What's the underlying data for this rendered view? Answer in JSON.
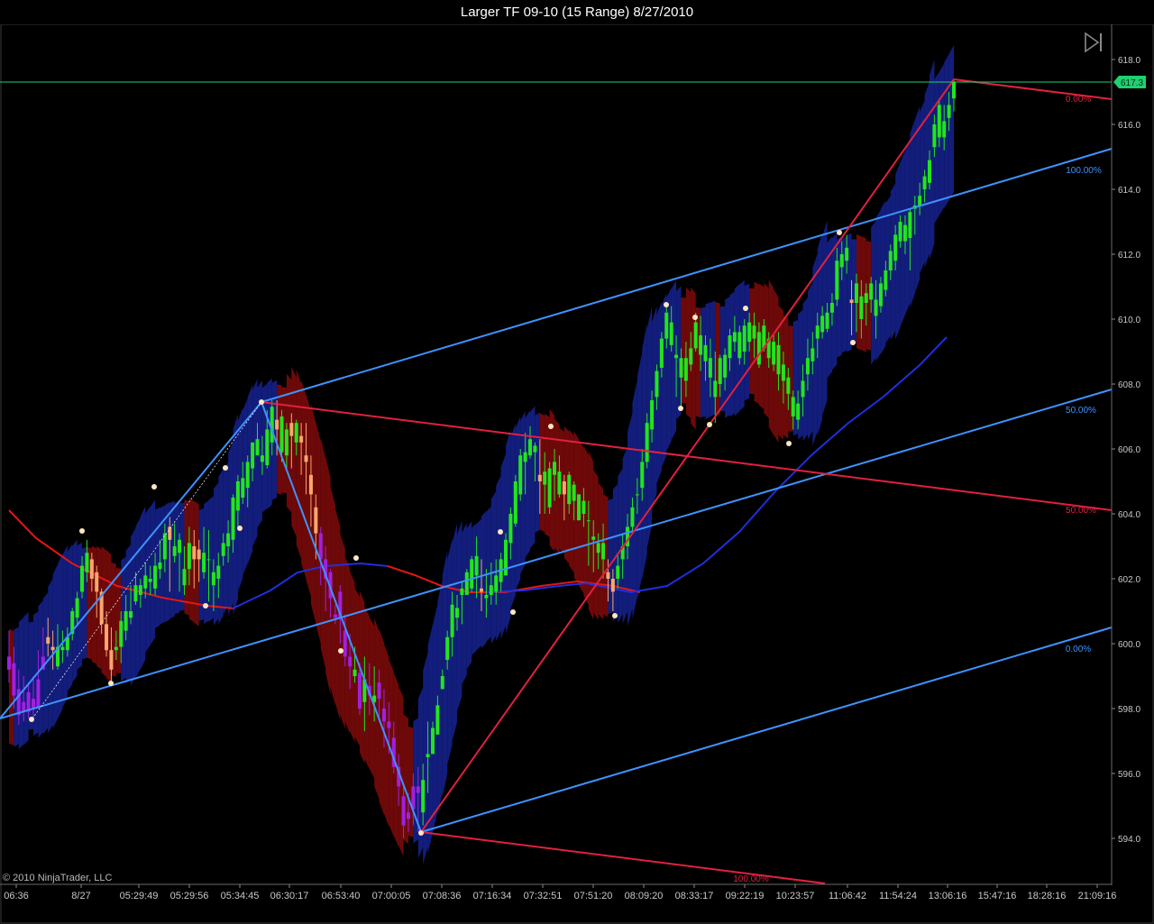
{
  "window": {
    "title": "Larger TF 09-10 (15 Range)  8/27/2010"
  },
  "copyright": "© 2010 NinjaTrader, LLC",
  "controls": {
    "forward_icon": "skip-forward-icon"
  },
  "colors": {
    "background": "#000000",
    "up_candle": "#22e51c",
    "down_candle": "#f7a76e",
    "purple_candle": "#a020e0",
    "blue_channel": "#3d93ff",
    "red_lines": "#e0213f",
    "ma_red": "#e31616",
    "ma_blue": "#1f2fe0",
    "band_blue": "#14208a",
    "band_red": "#7a0a0a",
    "price_marker": "#20d070",
    "axis_text": "#c8c8c8"
  },
  "chart_data": {
    "type": "candlestick",
    "title": "Larger TF 09-10 (15 Range)  8/27/2010",
    "ylim": [
      592.5,
      619.0
    ],
    "y_ticks": [
      "618.0",
      "616.0",
      "614.0",
      "612.0",
      "610.0",
      "608.0",
      "606.0",
      "604.0",
      "602.0",
      "600.0",
      "598.0",
      "596.0",
      "594.0"
    ],
    "x_ticks": [
      "06:36",
      "8/27",
      "05:29:49",
      "05:29:56",
      "05:34:45",
      "06:30:17",
      "06:53:40",
      "07:00:05",
      "07:08:36",
      "07:16:34",
      "07:32:51",
      "07:51:20",
      "08:09:20",
      "08:33:17",
      "09:22:19",
      "10:23:57",
      "11:06:42",
      "11:54:24",
      "13:06:16",
      "15:47:16",
      "18:28:16",
      "21:09:16"
    ],
    "last_price": "617.3",
    "grid": false,
    "channel_labels": [
      "100.00%",
      "50.00%",
      "0.00%"
    ],
    "red_labels": [
      "0.00%",
      "50.00%",
      "100.00%"
    ],
    "candles": [
      [
        599.6,
        600.4,
        599.2,
        598.8
      ],
      [
        599.4,
        599.9,
        598.4,
        598.0
      ],
      [
        598.6,
        599.2,
        597.8,
        597.5
      ],
      [
        598.2,
        599.0,
        597.9,
        597.6
      ],
      [
        598.5,
        598.8,
        597.9,
        597.7
      ],
      [
        598.3,
        599.0,
        598.0,
        597.6
      ],
      [
        598.9,
        599.8,
        598.0,
        598.6
      ],
      [
        599.6,
        600.5,
        599.2,
        599.2
      ],
      [
        600.2,
        600.8,
        600.0,
        599.6
      ],
      [
        599.9,
        600.4,
        599.8,
        599.2
      ],
      [
        599.3,
        600.6,
        599.9,
        599.2
      ],
      [
        599.8,
        600.4,
        599.9,
        599.4
      ],
      [
        599.8,
        600.5,
        600.2,
        599.6
      ],
      [
        600.3,
        601.1,
        601.0,
        600.1
      ],
      [
        600.8,
        601.6,
        601.4,
        600.6
      ],
      [
        601.6,
        602.7,
        602.4,
        601.4
      ],
      [
        602.2,
        603.2,
        602.8,
        601.9
      ],
      [
        602.6,
        602.8,
        602.0,
        601.6
      ],
      [
        602.2,
        602.4,
        601.6,
        600.8
      ],
      [
        601.6,
        601.7,
        600.6,
        600.3
      ],
      [
        600.6,
        601.0,
        599.8,
        599.6
      ],
      [
        599.8,
        600.5,
        599.2,
        598.8
      ],
      [
        599.8,
        600.4,
        599.9,
        599.5
      ],
      [
        599.9,
        601.0,
        600.7,
        599.4
      ],
      [
        600.4,
        601.5,
        601.0,
        600.1
      ],
      [
        600.8,
        601.8,
        601.0,
        600.6
      ],
      [
        601.3,
        602.2,
        601.8,
        601.2
      ],
      [
        601.5,
        602.0,
        601.8,
        601.1
      ],
      [
        601.7,
        602.5,
        602.1,
        601.4
      ],
      [
        601.9,
        602.4,
        602.0,
        601.5
      ],
      [
        601.7,
        602.8,
        602.4,
        601.5
      ],
      [
        602.3,
        603.2,
        602.5,
        602.0
      ],
      [
        602.6,
        603.7,
        603.4,
        602.2
      ],
      [
        603.6,
        603.9,
        603.2,
        601.6
      ],
      [
        602.7,
        603.7,
        603.0,
        602.5
      ],
      [
        602.8,
        603.4,
        603.2,
        601.6
      ],
      [
        601.8,
        603.0,
        602.3,
        601.5
      ],
      [
        602.3,
        603.6,
        603.1,
        601.8
      ],
      [
        603.0,
        603.5,
        602.6,
        601.7
      ],
      [
        602.9,
        603.2,
        602.6,
        601.9
      ],
      [
        602.2,
        603.6,
        602.8,
        602.0
      ],
      [
        602.6,
        603.5,
        602.6,
        601.3
      ],
      [
        601.8,
        602.6,
        602.2,
        601.0
      ],
      [
        602.0,
        602.8,
        602.4,
        601.4
      ],
      [
        602.7,
        603.4,
        603.1,
        602.4
      ],
      [
        603.0,
        603.8,
        603.4,
        602.5
      ],
      [
        603.2,
        604.6,
        604.5,
        602.8
      ],
      [
        604.1,
        605.2,
        605.0,
        603.6
      ],
      [
        604.5,
        605.6,
        605.1,
        604.3
      ],
      [
        604.8,
        605.8,
        605.6,
        604.2
      ],
      [
        605.4,
        606.2,
        606.2,
        605.0
      ],
      [
        605.8,
        606.8,
        606.3,
        605.8
      ],
      [
        605.6,
        606.4,
        605.8,
        605.2
      ],
      [
        605.5,
        607.2,
        606.6,
        605.4
      ],
      [
        606.2,
        607.5,
        607.3,
        605.8
      ],
      [
        606.9,
        607.5,
        606.6,
        605.8
      ],
      [
        605.9,
        607.2,
        607.0,
        605.6
      ],
      [
        605.8,
        606.8,
        606.6,
        605.4
      ],
      [
        606.8,
        607.1,
        606.4,
        605.4
      ],
      [
        606.2,
        606.9,
        606.8,
        605.8
      ],
      [
        606.4,
        606.8,
        606.2,
        605.2
      ],
      [
        605.8,
        606.8,
        605.6,
        604.6
      ],
      [
        605.2,
        605.8,
        604.6,
        603.6
      ],
      [
        604.2,
        604.6,
        603.4,
        602.6
      ],
      [
        603.4,
        603.6,
        602.6,
        601.8
      ],
      [
        602.6,
        603.0,
        602.0,
        601.0
      ],
      [
        602.2,
        602.3,
        601.4,
        600.8
      ],
      [
        600.9,
        601.2,
        600.8,
        600.6
      ],
      [
        601.6,
        601.8,
        600.8,
        600.0
      ],
      [
        600.4,
        600.9,
        599.6,
        599.3
      ],
      [
        599.6,
        600.3,
        599.3,
        598.6
      ],
      [
        599.0,
        599.9,
        599.2,
        598.8
      ],
      [
        599.1,
        599.4,
        598.0,
        597.8
      ],
      [
        598.2,
        599.6,
        598.9,
        597.3
      ],
      [
        598.7,
        599.4,
        598.4,
        597.8
      ],
      [
        598.2,
        599.3,
        598.4,
        597.6
      ],
      [
        598.8,
        599.2,
        598.3,
        597.6
      ],
      [
        598.0,
        598.6,
        597.6,
        596.8
      ],
      [
        597.6,
        598.2,
        597.4,
        596.6
      ],
      [
        597.1,
        597.6,
        596.2,
        596.0
      ],
      [
        596.2,
        596.6,
        595.6,
        595.0
      ],
      [
        595.3,
        595.6,
        594.4,
        594.0
      ],
      [
        594.8,
        595.4,
        594.6,
        594.2
      ],
      [
        595.6,
        596.0,
        594.9,
        594.4
      ],
      [
        595.6,
        596.2,
        595.4,
        594.2
      ],
      [
        594.8,
        596.3,
        595.8,
        594.4
      ],
      [
        596.5,
        597.6,
        596.6,
        595.4
      ],
      [
        596.6,
        597.6,
        597.4,
        596.6
      ],
      [
        597.2,
        598.4,
        598.1,
        597.2
      ],
      [
        598.6,
        599.2,
        599.0,
        598.6
      ],
      [
        599.5,
        600.4,
        600.2,
        599.2
      ],
      [
        600.2,
        601.6,
        601.2,
        599.6
      ],
      [
        600.8,
        601.5,
        601.1,
        600.4
      ],
      [
        601.5,
        601.9,
        601.7,
        600.6
      ],
      [
        601.5,
        602.3,
        602.2,
        601.6
      ],
      [
        601.7,
        602.7,
        602.6,
        601.6
      ],
      [
        602.1,
        603.3,
        602.7,
        601.4
      ],
      [
        601.7,
        602.6,
        601.6,
        601.0
      ],
      [
        601.4,
        602.3,
        601.5,
        600.8
      ],
      [
        601.5,
        602.5,
        601.8,
        601.2
      ],
      [
        601.6,
        602.6,
        602.1,
        601.2
      ],
      [
        601.9,
        602.8,
        602.6,
        601.6
      ],
      [
        602.1,
        603.4,
        603.2,
        602.2
      ],
      [
        603.1,
        604.2,
        604.0,
        602.6
      ],
      [
        603.7,
        605.2,
        605.0,
        603.6
      ],
      [
        604.6,
        606.0,
        605.8,
        604.4
      ],
      [
        605.6,
        606.5,
        605.9,
        604.6
      ],
      [
        605.8,
        606.7,
        606.3,
        605.7
      ],
      [
        605.9,
        606.2,
        606.1,
        605.0
      ],
      [
        605.2,
        606.3,
        605.0,
        604.0
      ],
      [
        604.9,
        605.9,
        605.3,
        604.0
      ],
      [
        604.2,
        605.6,
        605.4,
        604.0
      ],
      [
        605.2,
        606.0,
        605.6,
        604.4
      ],
      [
        604.6,
        605.8,
        605.3,
        604.5
      ],
      [
        605.0,
        605.2,
        604.6,
        603.8
      ],
      [
        604.3,
        605.3,
        605.2,
        604.0
      ],
      [
        604.4,
        605.0,
        604.9,
        603.8
      ],
      [
        603.8,
        604.6,
        604.6,
        603.8
      ],
      [
        604.0,
        604.8,
        604.4,
        603.6
      ],
      [
        603.8,
        604.4,
        603.8,
        602.4
      ],
      [
        603.2,
        603.8,
        603.3,
        602.2
      ],
      [
        602.8,
        603.4,
        603.1,
        602.3
      ],
      [
        602.6,
        603.7,
        603.1,
        602.0
      ],
      [
        602.2,
        602.6,
        602.0,
        601.3
      ],
      [
        602.0,
        602.3,
        601.6,
        601.0
      ],
      [
        602.0,
        602.8,
        602.4,
        601.7
      ],
      [
        602.6,
        603.4,
        603.0,
        602.0
      ],
      [
        603.0,
        604.0,
        603.6,
        602.6
      ],
      [
        603.6,
        604.5,
        604.2,
        603.4
      ],
      [
        604.6,
        605.1,
        604.6,
        604.0
      ],
      [
        604.8,
        606.0,
        605.6,
        604.4
      ],
      [
        605.6,
        607.1,
        606.8,
        605.4
      ],
      [
        606.6,
        607.8,
        607.5,
        606.2
      ],
      [
        607.6,
        608.6,
        608.4,
        607.2
      ],
      [
        608.5,
        609.6,
        609.4,
        608.2
      ],
      [
        609.4,
        610.4,
        610.2,
        609.1
      ],
      [
        609.2,
        610.4,
        609.9,
        609.0
      ],
      [
        608.8,
        609.5,
        608.9,
        607.6
      ],
      [
        608.2,
        609.1,
        608.8,
        607.2
      ],
      [
        608.1,
        609.3,
        608.8,
        607.6
      ],
      [
        608.6,
        609.6,
        609.1,
        608.4
      ],
      [
        609.1,
        610.2,
        609.9,
        609.0
      ],
      [
        608.9,
        610.1,
        609.5,
        608.4
      ],
      [
        608.7,
        609.5,
        609.2,
        608.1
      ],
      [
        608.2,
        609.4,
        608.8,
        607.6
      ],
      [
        607.6,
        609.0,
        608.1,
        606.8
      ],
      [
        608.0,
        608.9,
        608.8,
        607.6
      ],
      [
        608.2,
        609.1,
        608.9,
        607.8
      ],
      [
        608.8,
        609.7,
        609.5,
        608.4
      ],
      [
        609.3,
        610.1,
        609.6,
        609.0
      ],
      [
        608.8,
        609.8,
        609.6,
        608.6
      ],
      [
        609.0,
        610.0,
        609.8,
        608.6
      ],
      [
        609.3,
        610.2,
        609.9,
        609.0
      ],
      [
        609.4,
        610.2,
        609.8,
        608.8
      ],
      [
        608.6,
        609.9,
        609.6,
        608.5
      ],
      [
        609.1,
        610.0,
        609.8,
        609.0
      ],
      [
        608.8,
        609.6,
        609.4,
        608.5
      ],
      [
        608.6,
        609.5,
        609.3,
        608.4
      ],
      [
        608.3,
        609.6,
        609.2,
        607.8
      ],
      [
        608.1,
        609.0,
        608.6,
        607.4
      ],
      [
        607.7,
        608.5,
        608.2,
        607.2
      ],
      [
        607.0,
        607.8,
        607.6,
        606.6
      ],
      [
        606.9,
        607.8,
        607.4,
        606.6
      ],
      [
        607.6,
        608.6,
        608.1,
        607.0
      ],
      [
        608.3,
        609.4,
        608.8,
        607.8
      ],
      [
        608.7,
        609.6,
        609.1,
        608.3
      ],
      [
        609.4,
        610.2,
        609.8,
        608.8
      ],
      [
        609.6,
        610.4,
        610.1,
        609.4
      ],
      [
        609.7,
        610.5,
        610.2,
        609.6
      ],
      [
        610.2,
        610.8,
        610.5,
        609.8
      ],
      [
        610.6,
        612.2,
        611.8,
        610.4
      ],
      [
        611.6,
        612.4,
        612.0,
        611.2
      ],
      [
        611.8,
        612.6,
        612.2,
        611.4
      ],
      [
        610.6,
        611.2,
        610.5,
        609.5
      ],
      [
        610.5,
        611.4,
        611.1,
        609.6
      ],
      [
        610.0,
        611.2,
        610.7,
        609.4
      ],
      [
        610.5,
        611.1,
        610.8,
        609.8
      ],
      [
        610.6,
        611.3,
        611.1,
        610.2
      ],
      [
        610.1,
        611.2,
        610.6,
        609.4
      ],
      [
        610.4,
        611.3,
        611.1,
        610.2
      ],
      [
        610.9,
        611.8,
        611.5,
        610.7
      ],
      [
        611.5,
        612.3,
        612.1,
        611.2
      ],
      [
        611.8,
        612.9,
        612.6,
        611.5
      ],
      [
        612.4,
        613.2,
        613.0,
        612.2
      ],
      [
        612.4,
        613.2,
        612.9,
        612.0
      ],
      [
        612.5,
        613.4,
        613.3,
        611.5
      ],
      [
        613.4,
        613.8,
        613.5,
        612.6
      ],
      [
        613.5,
        614.2,
        613.8,
        613.2
      ],
      [
        614.0,
        614.6,
        614.4,
        613.6
      ],
      [
        614.2,
        615.2,
        614.9,
        614.0
      ],
      [
        615.3,
        616.3,
        616.0,
        615.0
      ],
      [
        615.6,
        616.8,
        616.6,
        615.3
      ],
      [
        615.6,
        616.6,
        616.1,
        615.2
      ],
      [
        616.2,
        617.0,
        616.6,
        615.8
      ],
      [
        616.8,
        617.4,
        617.3,
        616.4
      ]
    ]
  }
}
